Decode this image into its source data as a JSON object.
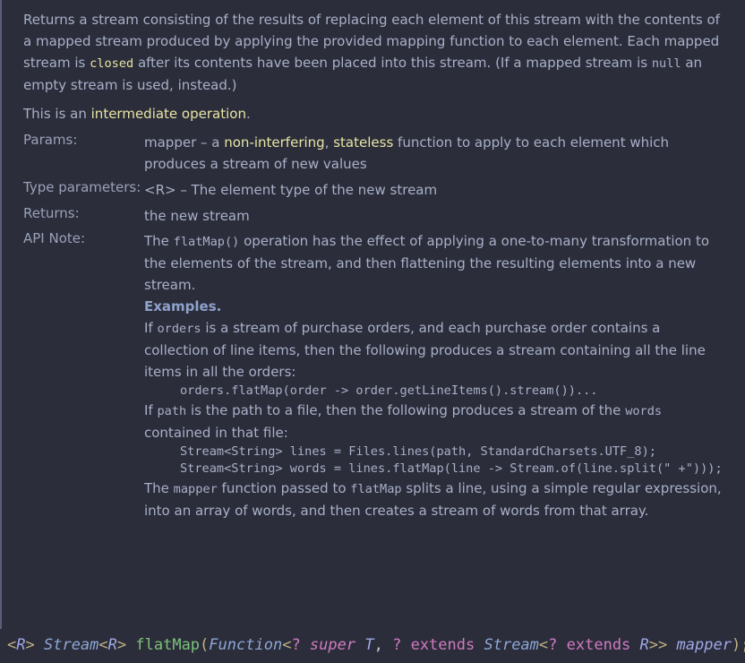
{
  "doc": {
    "intro_a": "Returns a stream consisting of the results of replacing each element of this stream with the contents of a mapped stream produced by applying the provided mapping function to each element. Each mapped stream is ",
    "intro_closed": "closed",
    "intro_b": " after its contents have been placed into this stream. (If a mapped stream is ",
    "intro_null": "null",
    "intro_c": " an empty stream is used, instead.)",
    "op_a": "This is an ",
    "op_link": "intermediate operation",
    "op_b": ".",
    "params": {
      "label": "Params:",
      "a": "mapper – a ",
      "link1": "non-interfering",
      "sep": ", ",
      "link2": "stateless",
      "b": " function to apply to each element which produces a stream of new values"
    },
    "type_params": {
      "label": "Type parameters:",
      "value": "<R> – The element type of the new stream"
    },
    "returns": {
      "label": "Returns:",
      "value": "the new stream"
    },
    "api_note": {
      "label": "API Note:",
      "p1_a": "The ",
      "p1_code": "flatMap()",
      "p1_b": " operation has the effect of applying a one-to-many transformation to the elements of the stream, and then flattening the resulting elements into a new stream.",
      "examples_heading": "Examples.",
      "p2_a": "If ",
      "p2_code": "orders",
      "p2_b": " is a stream of purchase orders, and each purchase order contains a collection of line items, then the following produces a stream containing all the line items in all the orders:",
      "code1": "orders.flatMap(order -> order.getLineItems().stream())...",
      "p3_a": "If ",
      "p3_code": "path",
      "p3_b": " is the path to a file, then the following produces a stream of the ",
      "p3_code2": "words",
      "p3_c": " contained in that file:",
      "code2_line1": "Stream<String> lines = Files.lines(path, StandardCharsets.UTF_8);",
      "code2_line2": "Stream<String> words = lines.flatMap(line -> Stream.of(line.split(\" +\")));",
      "p4_a": "The ",
      "p4_code": "mapper",
      "p4_b": " function passed to ",
      "p4_code2": "flatMap",
      "p4_c": " splits a line, using a simple regular expression, into an array of words, and then creates a stream of words from that array."
    }
  },
  "signature": {
    "t1": "<",
    "t2": "R",
    "t3": "> ",
    "t4": "Stream",
    "t5": "<",
    "t6": "R",
    "t7": "> ",
    "t8": "flatMap",
    "t9": "(",
    "t10": "Function",
    "t11": "<",
    "t12": "? ",
    "t13": "super",
    "t14": " ",
    "t15": "T",
    "t16": ", ",
    "t17": "? ",
    "t18": "extends",
    "t19": " ",
    "t20": "Stream",
    "t21": "<",
    "t22": "? ",
    "t23": "extends",
    "t24": " ",
    "t25": "R",
    "t26": ">>",
    "t27": " ",
    "t28": "mapper",
    "t29": ");"
  }
}
